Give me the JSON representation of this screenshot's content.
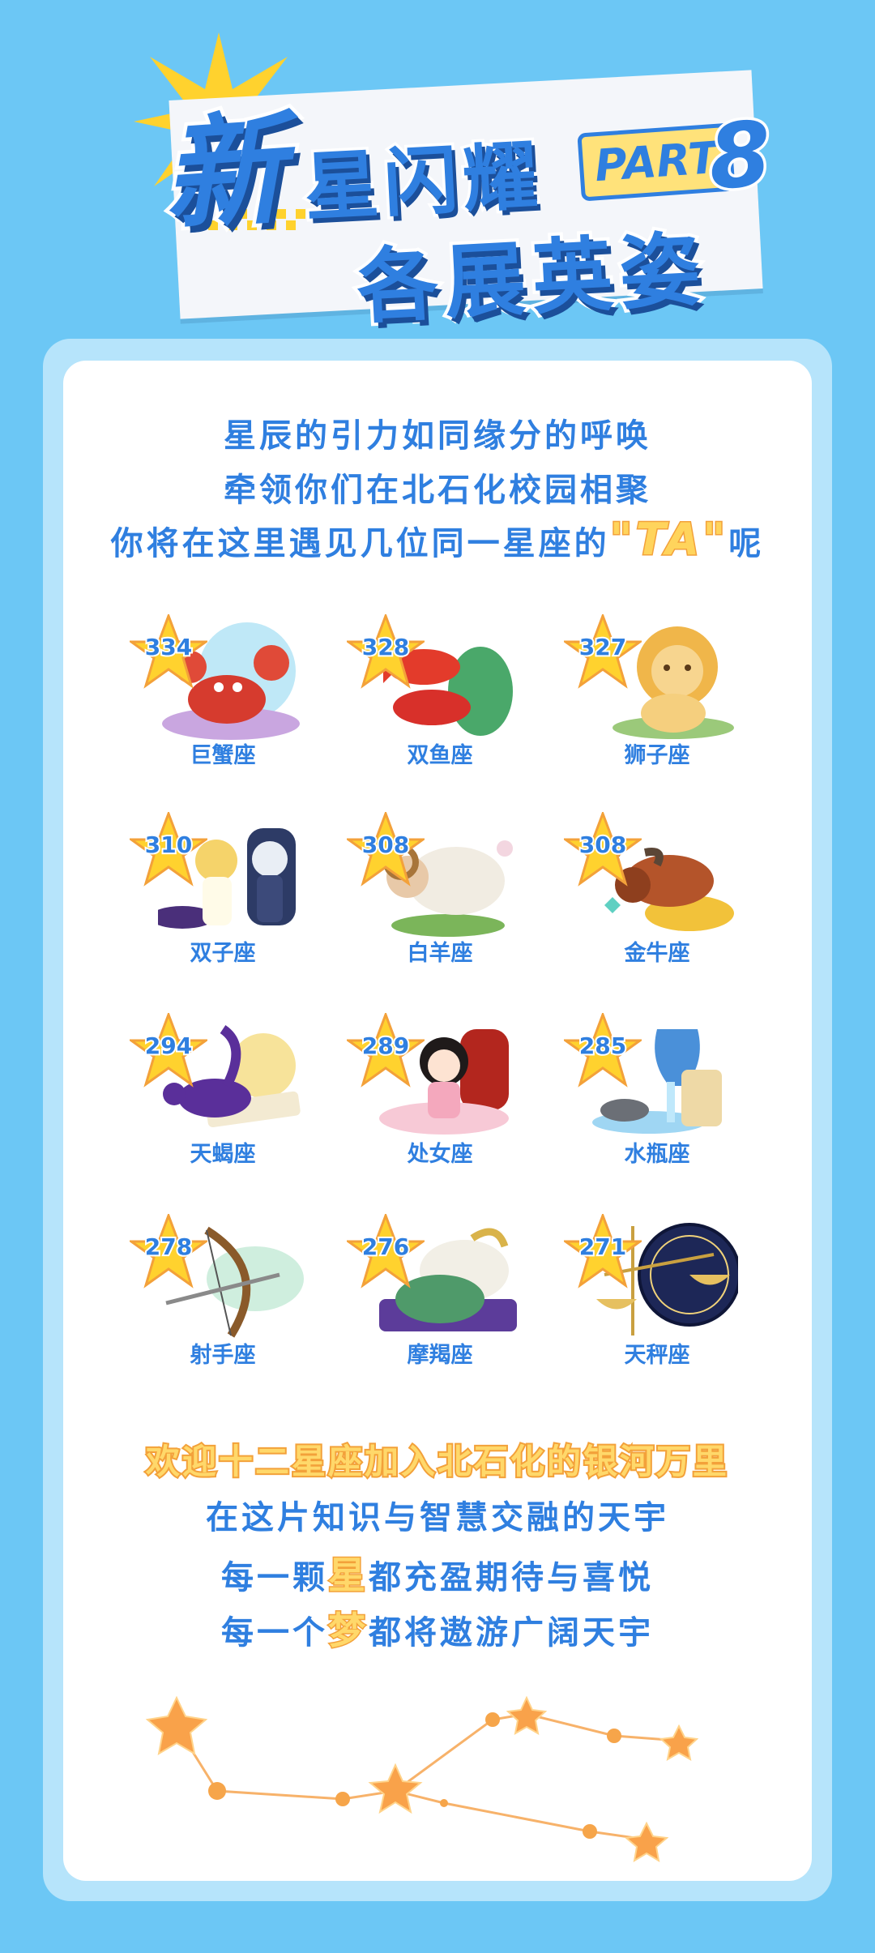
{
  "header": {
    "title_char": "新",
    "title_line1": "星闪耀",
    "part_label": "PART",
    "part_number": "8",
    "title_line2": "各展英姿"
  },
  "intro": {
    "line1": "星辰的引力如同缘分的呼唤",
    "line2": "牵领你们在北石化校园相聚",
    "line3_before": "你将在这里遇见几位同一星座的",
    "line3_highlight": "\"TA\"",
    "line3_after": "呢"
  },
  "zodiacs": [
    {
      "count": "334",
      "name": "巨蟹座",
      "icon": "crab-icon"
    },
    {
      "count": "328",
      "name": "双鱼座",
      "icon": "fish-icon"
    },
    {
      "count": "327",
      "name": "狮子座",
      "icon": "lion-icon"
    },
    {
      "count": "310",
      "name": "双子座",
      "icon": "twins-icon"
    },
    {
      "count": "308",
      "name": "白羊座",
      "icon": "ram-icon"
    },
    {
      "count": "308",
      "name": "金牛座",
      "icon": "bull-icon"
    },
    {
      "count": "294",
      "name": "天蝎座",
      "icon": "scorpion-icon"
    },
    {
      "count": "289",
      "name": "处女座",
      "icon": "maiden-icon"
    },
    {
      "count": "285",
      "name": "水瓶座",
      "icon": "water-bearer-icon"
    },
    {
      "count": "278",
      "name": "射手座",
      "icon": "bow-icon"
    },
    {
      "count": "276",
      "name": "摩羯座",
      "icon": "goat-icon"
    },
    {
      "count": "271",
      "name": "天秤座",
      "icon": "scales-icon"
    }
  ],
  "footer": {
    "welcome": "欢迎十二星座加入北石化的银河万里",
    "line1": "在这片知识与智慧交融的天宇",
    "line2_before": "每一颗",
    "line2_highlight": "星",
    "line2_after": "都充盈期待与喜悦",
    "line3_before": "每一个",
    "line3_highlight": "梦",
    "line3_after": "都将遨游广阔天宇"
  },
  "colors": {
    "background": "#6cc7f5",
    "primary_blue": "#2f7fe0",
    "star_yellow": "#ffd45c",
    "accent_orange": "#f3a13a"
  }
}
